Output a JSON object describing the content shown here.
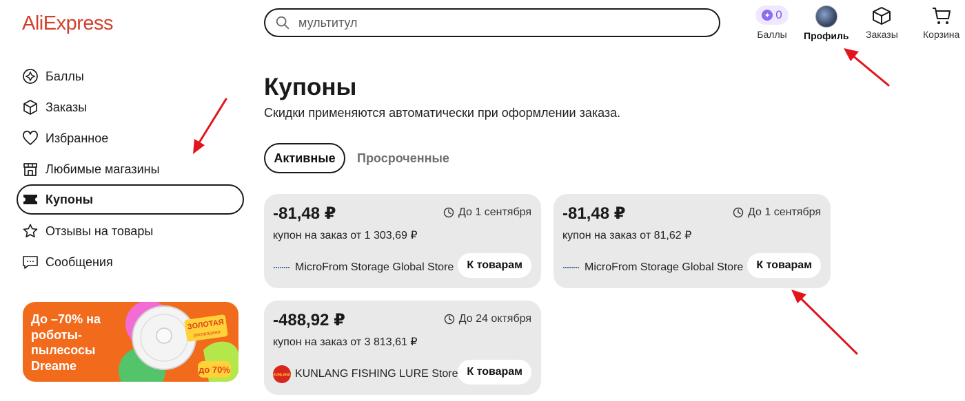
{
  "header": {
    "logo": "AliExpress",
    "search_value": "мультитул",
    "points": {
      "count": "0",
      "label": "Баллы"
    },
    "profile_label": "Профиль",
    "orders_label": "Заказы",
    "cart_label": "Корзина"
  },
  "sidebar": {
    "items": [
      {
        "label": "Баллы",
        "icon": "points-icon"
      },
      {
        "label": "Заказы",
        "icon": "box-icon"
      },
      {
        "label": "Избранное",
        "icon": "heart-icon"
      },
      {
        "label": "Любимые магазины",
        "icon": "store-icon"
      },
      {
        "label": "Купоны",
        "icon": "coupon-icon",
        "active": true
      },
      {
        "label": "Отзывы на товары",
        "icon": "star-icon"
      },
      {
        "label": "Сообщения",
        "icon": "message-icon"
      }
    ],
    "promo": {
      "text": "До –70% на роботы-пылесосы Dreame",
      "badge_title": "ЗОЛОТАЯ",
      "badge_sub": "распродажа",
      "badge_discount": "до 70%"
    }
  },
  "main": {
    "title": "Купоны",
    "subtitle": "Скидки применяются автоматически при оформлении заказа.",
    "tabs": [
      {
        "label": "Активные",
        "active": true
      },
      {
        "label": "Просроченные",
        "active": false
      }
    ],
    "coupons": [
      {
        "amount": "-81,48 ₽",
        "expiry": "До 1 сентября",
        "min_order": "купон на заказ от 1 303,69 ₽",
        "store": "MicroFrom Storage Global Store",
        "button": "К товарам"
      },
      {
        "amount": "-81,48 ₽",
        "expiry": "До 1 сентября",
        "min_order": "купон на заказ от 81,62 ₽",
        "store": "MicroFrom Storage Global Store",
        "button": "К товарам"
      },
      {
        "amount": "-488,92 ₽",
        "expiry": "До 24 октября",
        "min_order": "купон на заказ от 3 813,61 ₽",
        "store": "KUNLANG FISHING LURE Store",
        "store_logo_text": "KUNLANG",
        "button": "К товарам"
      }
    ]
  },
  "colors": {
    "brand": "#d23f2a",
    "coupon_bg": "#e9e9e9",
    "promo_bg": "#f26a1b",
    "annotation_arrow": "#e3141b"
  }
}
